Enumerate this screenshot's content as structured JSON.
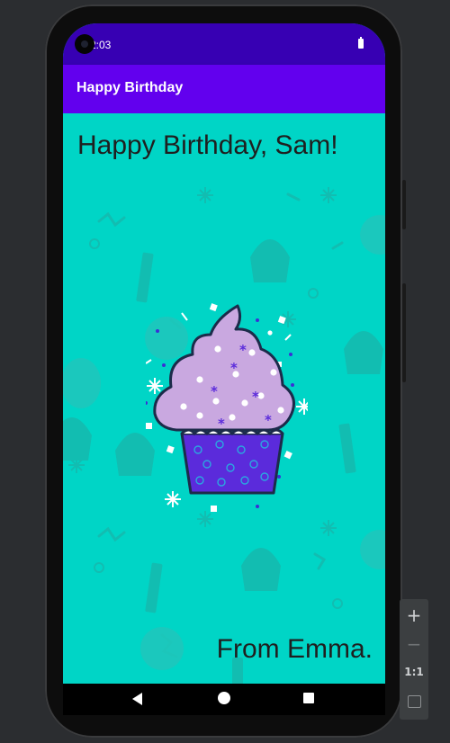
{
  "status_bar": {
    "time": "2:03",
    "battery_icon": "battery-icon",
    "colors": {
      "background": "#3700b3"
    }
  },
  "app_bar": {
    "title": "Happy Birthday",
    "colors": {
      "background": "#6200ee"
    }
  },
  "content": {
    "greeting": "Happy Birthday, Sam!",
    "signoff": "From Emma.",
    "colors": {
      "background": "#00d5c6",
      "cupcake_frosting": "#c9a8e0",
      "cupcake_wrapper": "#5b2bdb"
    }
  },
  "nav_bar": {
    "back_icon": "back-triangle-icon",
    "home_icon": "home-circle-icon",
    "recents_icon": "recents-square-icon"
  },
  "zoom_controls": {
    "zoom_in": "+",
    "zoom_out": "−",
    "actual_size": "1:1",
    "fit_icon": "fit-screen-icon"
  }
}
